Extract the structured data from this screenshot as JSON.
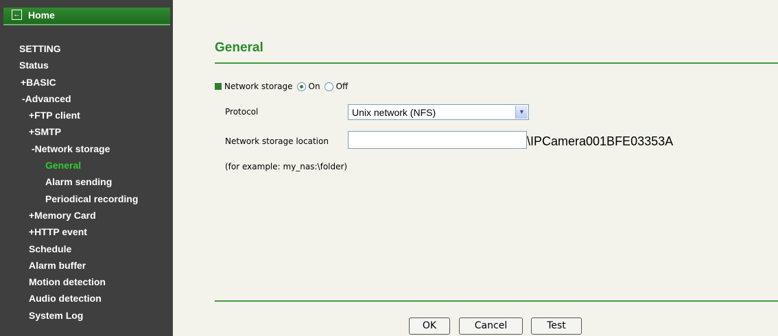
{
  "sidebar": {
    "home_label": "Home",
    "items": [
      {
        "label": "SETTING",
        "indent": 0,
        "active": false
      },
      {
        "label": "Status",
        "indent": 0,
        "active": false
      },
      {
        "label": "+BASIC",
        "indent": 1,
        "active": false
      },
      {
        "label": "-Advanced",
        "indent": 1,
        "active": false
      },
      {
        "label": "+FTP client",
        "indent": 2,
        "active": false
      },
      {
        "label": "+SMTP",
        "indent": 2,
        "active": false
      },
      {
        "label": "-Network storage",
        "indent": 2,
        "active": false
      },
      {
        "label": "General",
        "indent": 3,
        "active": true
      },
      {
        "label": "Alarm sending",
        "indent": 3,
        "active": false
      },
      {
        "label": "Periodical recording",
        "indent": 3,
        "active": false
      },
      {
        "label": "+Memory Card",
        "indent": 2,
        "active": false
      },
      {
        "label": "+HTTP event",
        "indent": 2,
        "active": false
      },
      {
        "label": "Schedule",
        "indent": 2,
        "active": false
      },
      {
        "label": "Alarm buffer",
        "indent": 2,
        "active": false
      },
      {
        "label": "Motion detection",
        "indent": 2,
        "active": false
      },
      {
        "label": "Audio detection",
        "indent": 2,
        "active": false
      },
      {
        "label": "System Log",
        "indent": 2,
        "active": false
      }
    ]
  },
  "main": {
    "title": "General",
    "network_storage": {
      "label": "Network storage",
      "on_label": "On",
      "off_label": "Off",
      "selected": "On"
    },
    "protocol": {
      "label": "Protocol",
      "selected": "Unix network (NFS)"
    },
    "location": {
      "label": "Network storage location",
      "value": "",
      "suffix": "\\IPCamera001BFE03353A",
      "example": "(for example: my_nas:\\folder)"
    },
    "buttons": {
      "ok": "OK",
      "cancel": "Cancel",
      "test": "Test"
    }
  },
  "colors": {
    "sidebar_bg": "#3f3f3f",
    "accent_green": "#2a8a2a",
    "active_nav": "#33cc33",
    "content_bg": "#f3f3ec"
  }
}
